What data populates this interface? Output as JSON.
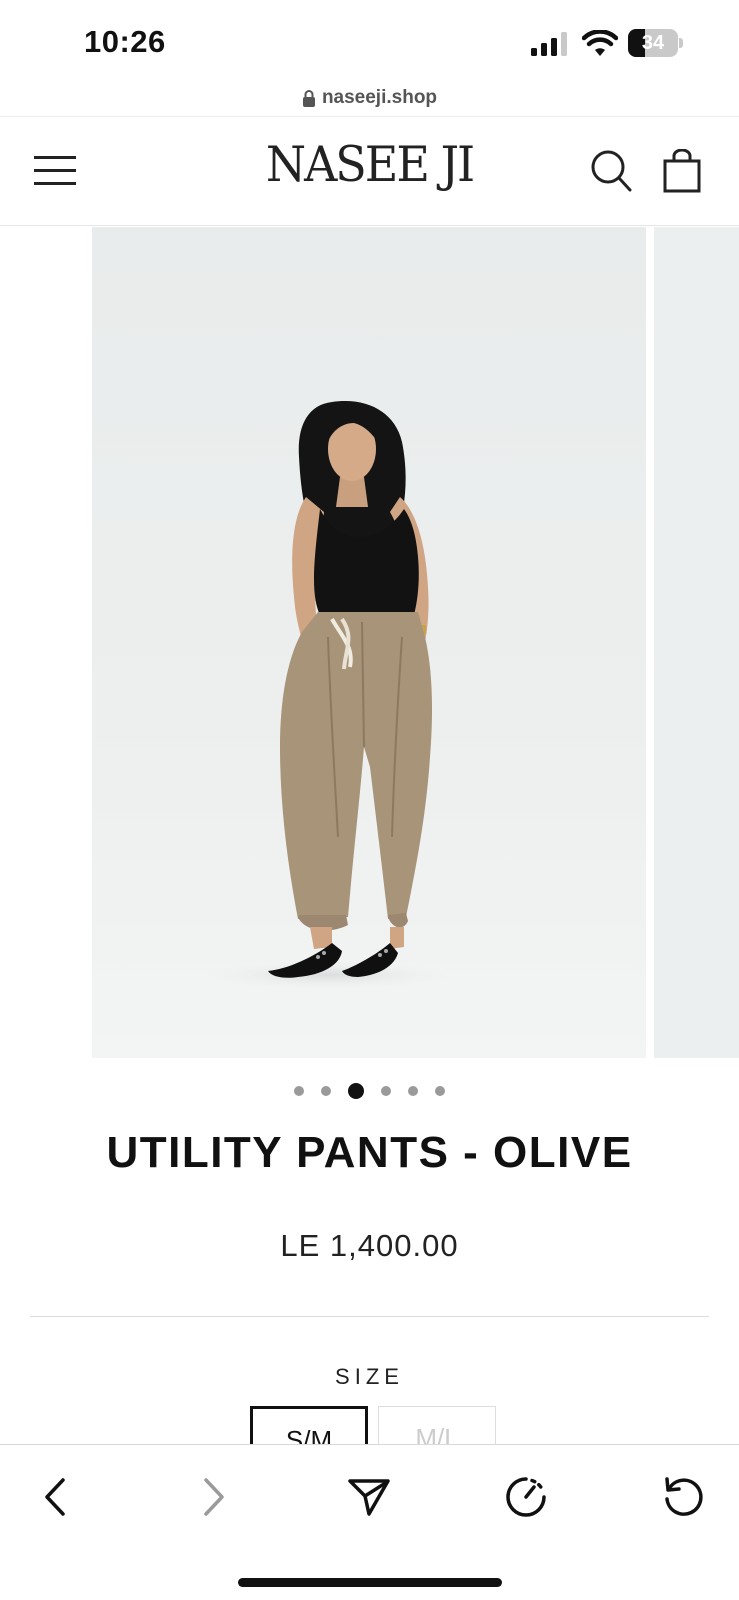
{
  "status_bar": {
    "time": "10:26",
    "battery_level": "34",
    "battery_fraction": 0.34,
    "icons": [
      "cellular-signal-icon",
      "wifi-icon",
      "battery-icon"
    ]
  },
  "browser": {
    "url": "naseeji.shop",
    "toolbar_icons": [
      "back-icon",
      "forward-icon",
      "share-icon",
      "speed-dial-icon",
      "reload-icon"
    ]
  },
  "header": {
    "logo": "NASEE JI",
    "icons": [
      "menu-icon",
      "search-icon",
      "cart-icon"
    ]
  },
  "gallery": {
    "slide_count": 6,
    "active_slide_index": 2,
    "zoom_icon": "zoom-icon"
  },
  "product": {
    "title": "UTILITY PANTS - OLIVE",
    "price": "LE 1,400.00"
  },
  "size": {
    "label": "SIZE",
    "options": [
      {
        "label": "S/M",
        "state": "selected"
      },
      {
        "label": "M/L",
        "state": "sold-out"
      }
    ]
  },
  "colors": {
    "text": "#111111",
    "inactive_dot": "#9a9a9a",
    "background": "#ffffff",
    "pants": "#a89478",
    "top": "#111111"
  }
}
